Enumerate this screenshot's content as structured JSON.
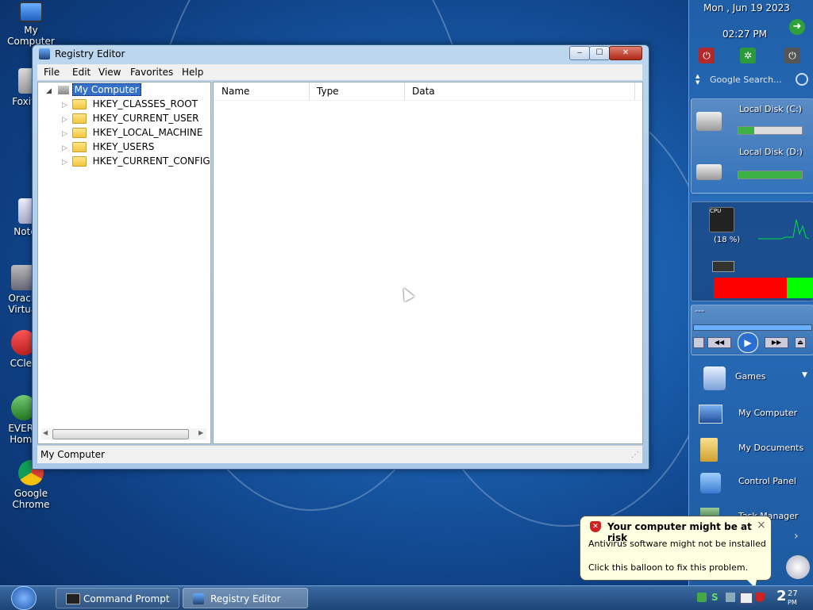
{
  "desktop": {
    "icons": [
      {
        "label": "My Computer"
      },
      {
        "label": "Foxit Re"
      },
      {
        "label": "Notepa"
      },
      {
        "label": "Oracle Virtual"
      },
      {
        "label": "CClea"
      },
      {
        "label": "EVERE Home"
      },
      {
        "label": "Google Chrome"
      }
    ]
  },
  "sidebar": {
    "date": "Mon , Jun 19 2023",
    "time": "02:27 PM",
    "search_placeholder": "Google Search...",
    "disks": [
      {
        "label": "Local Disk (C:)",
        "usage": 0.25
      },
      {
        "label": "Local Disk (D:)",
        "usage": 1.0
      }
    ],
    "cpu_label": "CPU",
    "cpu_percent": "(18 %)",
    "media_title": "---",
    "shortcuts": [
      "Games",
      "My Computer",
      "My Documents",
      "Control Panel",
      "Task Manager"
    ]
  },
  "window": {
    "title": "Registry Editor",
    "menu": [
      "File",
      "Edit",
      "View",
      "Favorites",
      "Help"
    ],
    "tree": {
      "root": "My Computer",
      "children": [
        "HKEY_CLASSES_ROOT",
        "HKEY_CURRENT_USER",
        "HKEY_LOCAL_MACHINE",
        "HKEY_USERS",
        "HKEY_CURRENT_CONFIG"
      ]
    },
    "columns": [
      "Name",
      "Type",
      "Data"
    ],
    "status": "My Computer"
  },
  "balloon": {
    "title": "Your computer might be at risk",
    "line1": "Antivirus software might not be installed",
    "line2": "Click this balloon to fix this problem.",
    "close": "×"
  },
  "taskbar": {
    "tasks": [
      "Command Prompt",
      "Registry Editor"
    ],
    "clock_hour": "2",
    "clock_min": "27",
    "clock_ampm": "PM"
  },
  "colors": {
    "accent": "#1d5aa0",
    "balloon_bg": "#ffffe1",
    "mem_red": "#ff0000",
    "mem_green": "#00ff00"
  }
}
